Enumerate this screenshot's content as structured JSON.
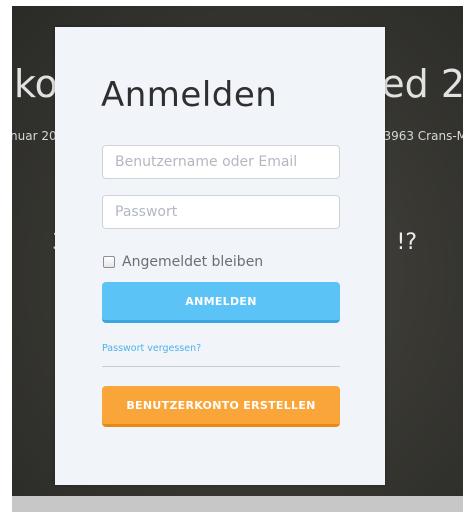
{
  "background": {
    "title_left": "ko",
    "title_right": "ed 2",
    "date_fragment": "nuar 20",
    "location_fragment": "3963 Crans-M",
    "middle_left": "3(",
    "middle_right": "!?"
  },
  "login": {
    "title": "Anmelden",
    "username_placeholder": "Benutzername oder Email",
    "password_placeholder": "Passwort",
    "remember_label": "Angemeldet bleiben",
    "login_button": "ANMELDEN",
    "forgot_link": "Passwort vergessen?",
    "register_button": "BENUTZERKONTO ERSTELLEN"
  },
  "colors": {
    "login_button": "#5bc3f5",
    "register_button": "#f9a53a",
    "link": "#4eb3ea",
    "modal_bg": "#f1f4f9"
  }
}
